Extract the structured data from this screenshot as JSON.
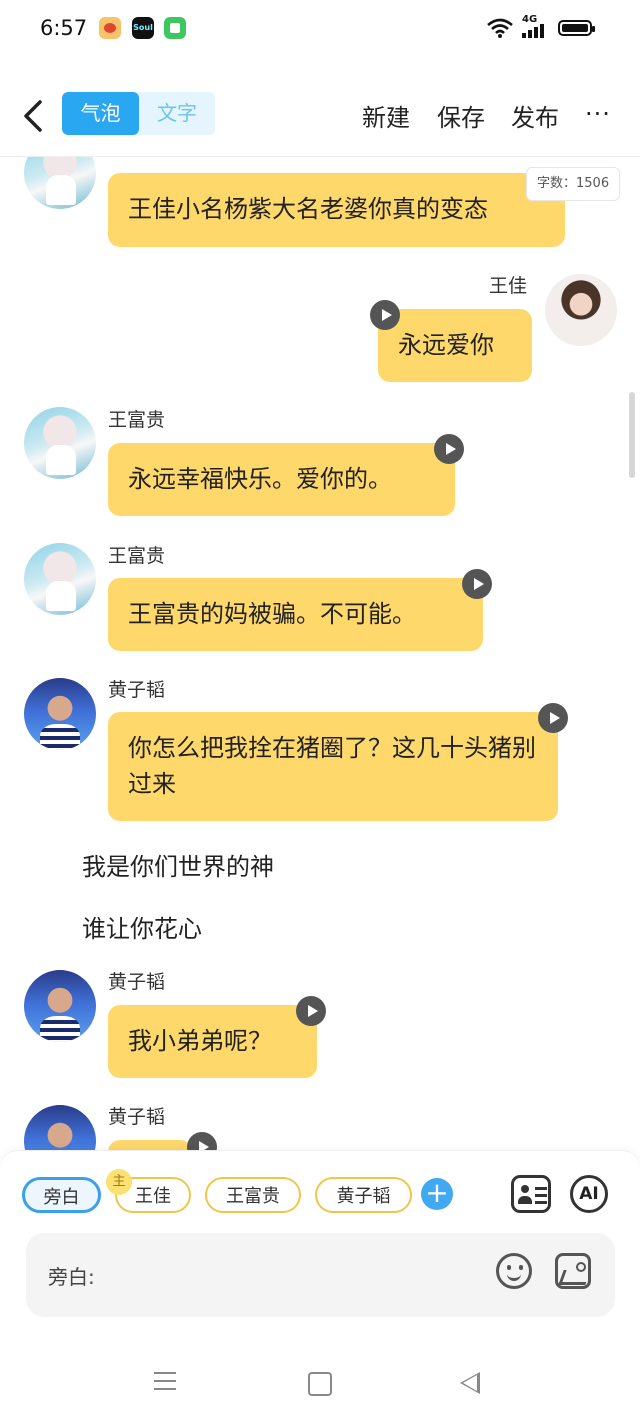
{
  "status": {
    "time": "6:57",
    "network": "4G"
  },
  "nav": {
    "toggle_bubble": "气泡",
    "toggle_text": "文字",
    "new": "新建",
    "save": "保存",
    "publish": "发布",
    "more": "···"
  },
  "word_count": "字数：1506",
  "messages": [
    {
      "type": "bubble",
      "speaker": "",
      "text": "王佳小名杨紫大名老婆你真的变态"
    },
    {
      "type": "bubble",
      "speaker": "王佳",
      "text": "永远爱你"
    },
    {
      "type": "bubble",
      "speaker": "王富贵",
      "text": "永远幸福快乐。爱你的。"
    },
    {
      "type": "bubble",
      "speaker": "王富贵",
      "text": "王富贵的妈被骗。不可能。"
    },
    {
      "type": "bubble",
      "speaker": "黄子韬",
      "text": "你怎么把我拴在猪圈了？这几十头猪别过来"
    },
    {
      "type": "narration",
      "text": "我是你们世界的神"
    },
    {
      "type": "narration",
      "text": "谁让你花心"
    },
    {
      "type": "bubble",
      "speaker": "黄子韬",
      "text": "我小弟弟呢？"
    },
    {
      "type": "bubble",
      "speaker": "黄子韬",
      "text": ""
    }
  ],
  "roles": {
    "narrator": "旁白",
    "main_badge": "主",
    "items": [
      "王佳",
      "王富贵",
      "黄子韬"
    ],
    "add": "+",
    "ai": "AI"
  },
  "input": {
    "prefix": "旁白:"
  },
  "colors": {
    "bubble": "#fed86b",
    "accent": "#2aa7f1",
    "chip_border": "#f0c64a"
  },
  "icons": [
    "back-arrow-icon",
    "play-icon",
    "add-icon",
    "contact-card-icon",
    "ai-icon",
    "emoji-icon",
    "image-icon",
    "menu-icon",
    "home-icon",
    "back-triangle-icon"
  ]
}
